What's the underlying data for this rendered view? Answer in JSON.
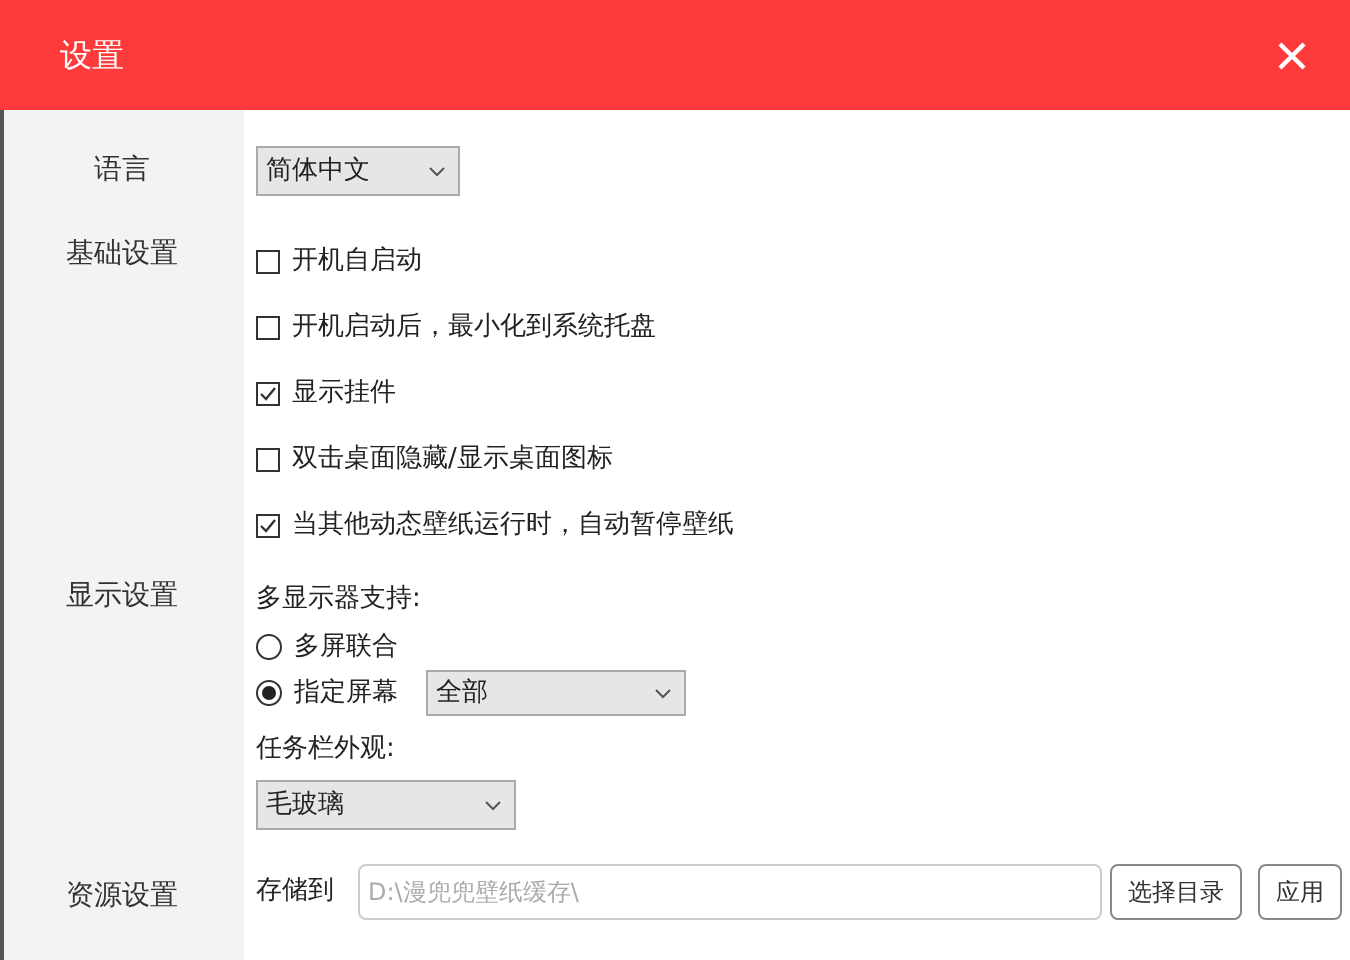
{
  "window": {
    "title": "设置"
  },
  "sections": [
    {
      "kind": "select",
      "label": "语言",
      "value": "简体中文"
    },
    {
      "kind": "checks",
      "label": "基础设置",
      "options": [
        {
          "label": "开机自启动",
          "checked": false
        },
        {
          "label": "开机启动后，最小化到系统托盘",
          "checked": false
        },
        {
          "label": "显示挂件",
          "checked": true
        },
        {
          "label": "双击桌面隐藏/显示桌面图标",
          "checked": false
        },
        {
          "label": "当其他动态壁纸运行时，自动暂停壁纸",
          "checked": true
        }
      ]
    },
    {
      "kind": "display",
      "label": "显示设置",
      "multi_label": "多显示器支持:",
      "radios": [
        {
          "label": "多屏联合",
          "selected": false
        },
        {
          "label": "指定屏幕",
          "selected": true,
          "select": "全部"
        }
      ],
      "taskbar_label": "任务栏外观:",
      "taskbar_value": "毛玻璃"
    },
    {
      "kind": "storage",
      "label": "资源设置",
      "field_label": "存储到",
      "placeholder": "D:\\漫兜兜壁纸缓存\\",
      "buttons": [
        "选择目录",
        "应用"
      ]
    }
  ]
}
